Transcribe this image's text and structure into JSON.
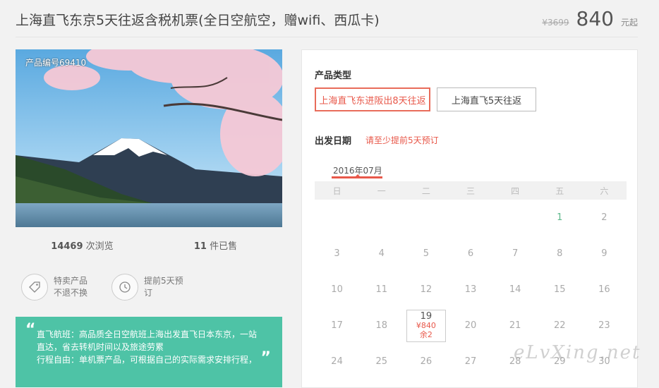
{
  "header": {
    "title": "上海直飞东京5天往返含税机票(全日空航空，赠wifi、西瓜卡)",
    "old_price": "¥3699",
    "price": "840",
    "price_suffix": "元起"
  },
  "photo": {
    "code_label": "产品编号69410"
  },
  "stats": {
    "views_count": "14469",
    "views_label": "次浏览",
    "sold_count": "11",
    "sold_label": "件已售"
  },
  "features": [
    {
      "icon": "tag-icon",
      "line1": "特卖产品",
      "line2": "不退不换"
    },
    {
      "icon": "clock-icon",
      "line1": "提前5天预",
      "line2": "订"
    }
  ],
  "quote": {
    "open_mark": "“",
    "close_mark": "”",
    "line1": "直飞航班：高品质全日空航班上海出发直飞日本东京，一站",
    "line2": "直达，省去转机时间以及旅途劳累",
    "line3": "行程自由：单机票产品，可根据自己的实际需求安排行程，"
  },
  "booking": {
    "product_type_label": "产品类型",
    "options": [
      "上海直飞东进阪出8天往返",
      "上海直飞5天往返"
    ],
    "selected_option": 0,
    "departure_label": "出发日期",
    "hint": "请至少提前5天预订"
  },
  "calendar": {
    "month": "2016年07月",
    "weekdays": [
      "日",
      "一",
      "二",
      "三",
      "四",
      "五",
      "六"
    ],
    "days": [
      [
        "",
        "",
        "",
        "",
        "",
        "1",
        "2"
      ],
      [
        "3",
        "4",
        "5",
        "6",
        "7",
        "8",
        "9"
      ],
      [
        "10",
        "11",
        "12",
        "13",
        "14",
        "15",
        "16"
      ],
      [
        "17",
        "18",
        "19",
        "20",
        "21",
        "22",
        "23"
      ],
      [
        "24",
        "25",
        "26",
        "27",
        "28",
        "29",
        "30"
      ]
    ],
    "available": {
      "day": "19",
      "price": "¥840",
      "remaining": "余2"
    }
  },
  "watermark": "eLvXing.net",
  "colors": {
    "accent": "#e8584a",
    "quote_bg": "#4ec3a6",
    "highlight_day": "#5cb88a"
  }
}
